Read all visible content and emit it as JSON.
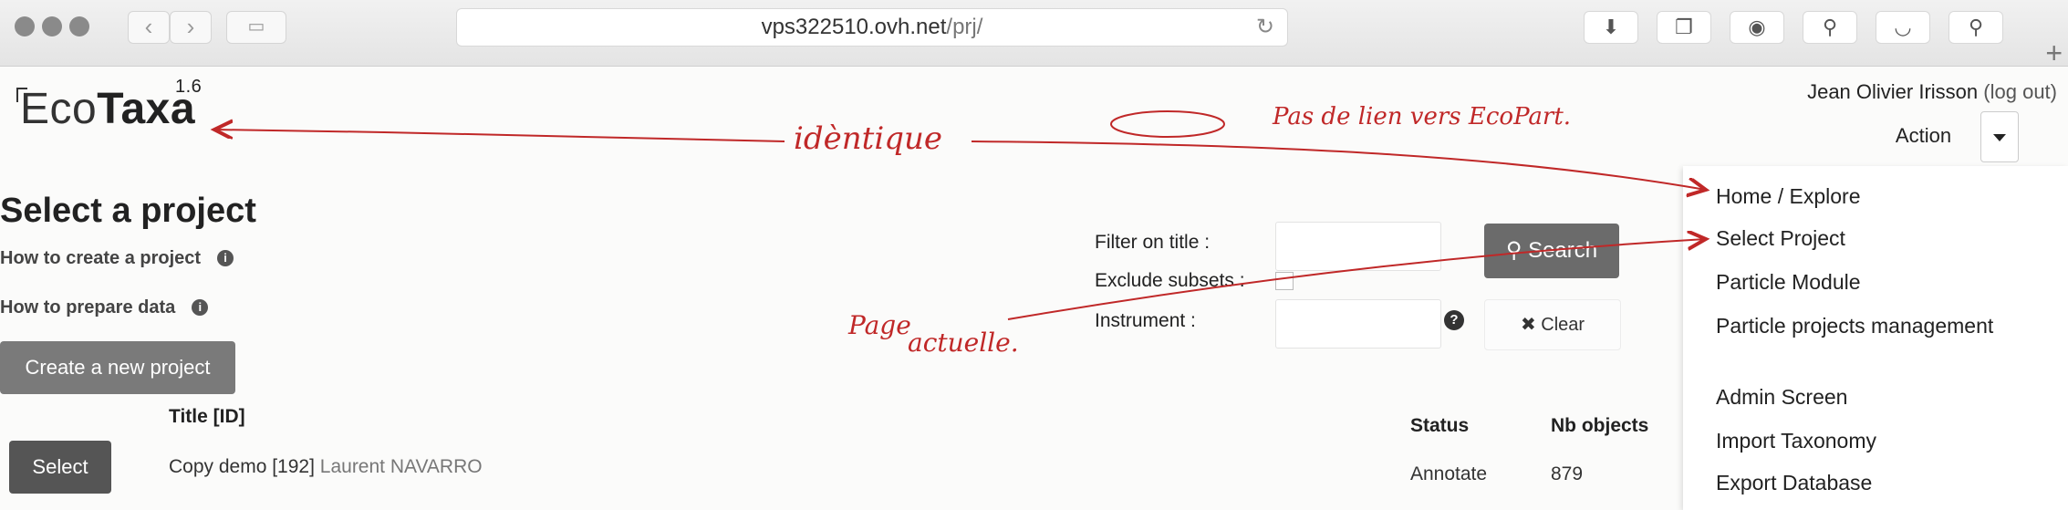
{
  "browser": {
    "url_host": "vps322510.ovh.net",
    "url_path": "/prj/",
    "plus_label": "+"
  },
  "app": {
    "logo_eco": "Eco",
    "logo_taxa": "Taxa",
    "version": "1.6"
  },
  "header": {
    "user_name": "Jean Olivier Irisson",
    "logout_label": "(log out)",
    "action_label": "Action"
  },
  "action_menu": {
    "items": [
      "Home / Explore",
      "Select Project",
      "Particle Module",
      "Particle projects management",
      "Admin Screen",
      "Import Taxonomy",
      "Export Database"
    ]
  },
  "main": {
    "title": "Select a project",
    "help_create": "How to create a project",
    "help_prepare": "How to prepare data",
    "create_button": "Create a new project"
  },
  "filters": {
    "title_label": "Filter on title :",
    "exclude_label": "Exclude subsets :",
    "instrument_label": "Instrument :",
    "search_label": "Search",
    "clear_label": "Clear"
  },
  "table": {
    "col_title": "Title [ID]",
    "col_status": "Status",
    "col_nb": "Nb objects",
    "rows": [
      {
        "select_label": "Select",
        "title": "Copy demo [192]",
        "owner": "Laurent NAVARRO",
        "status": "Annotate",
        "nb": "879"
      }
    ]
  },
  "annotations": {
    "identique": "idèntique",
    "pas_de_lien": "Pas de lien vers EcoPart.",
    "page_actuelle_1": "Page",
    "page_actuelle_2": "actuelle."
  },
  "colors": {
    "annotation": "#c02828",
    "button_dark": "#6b6b6b"
  }
}
